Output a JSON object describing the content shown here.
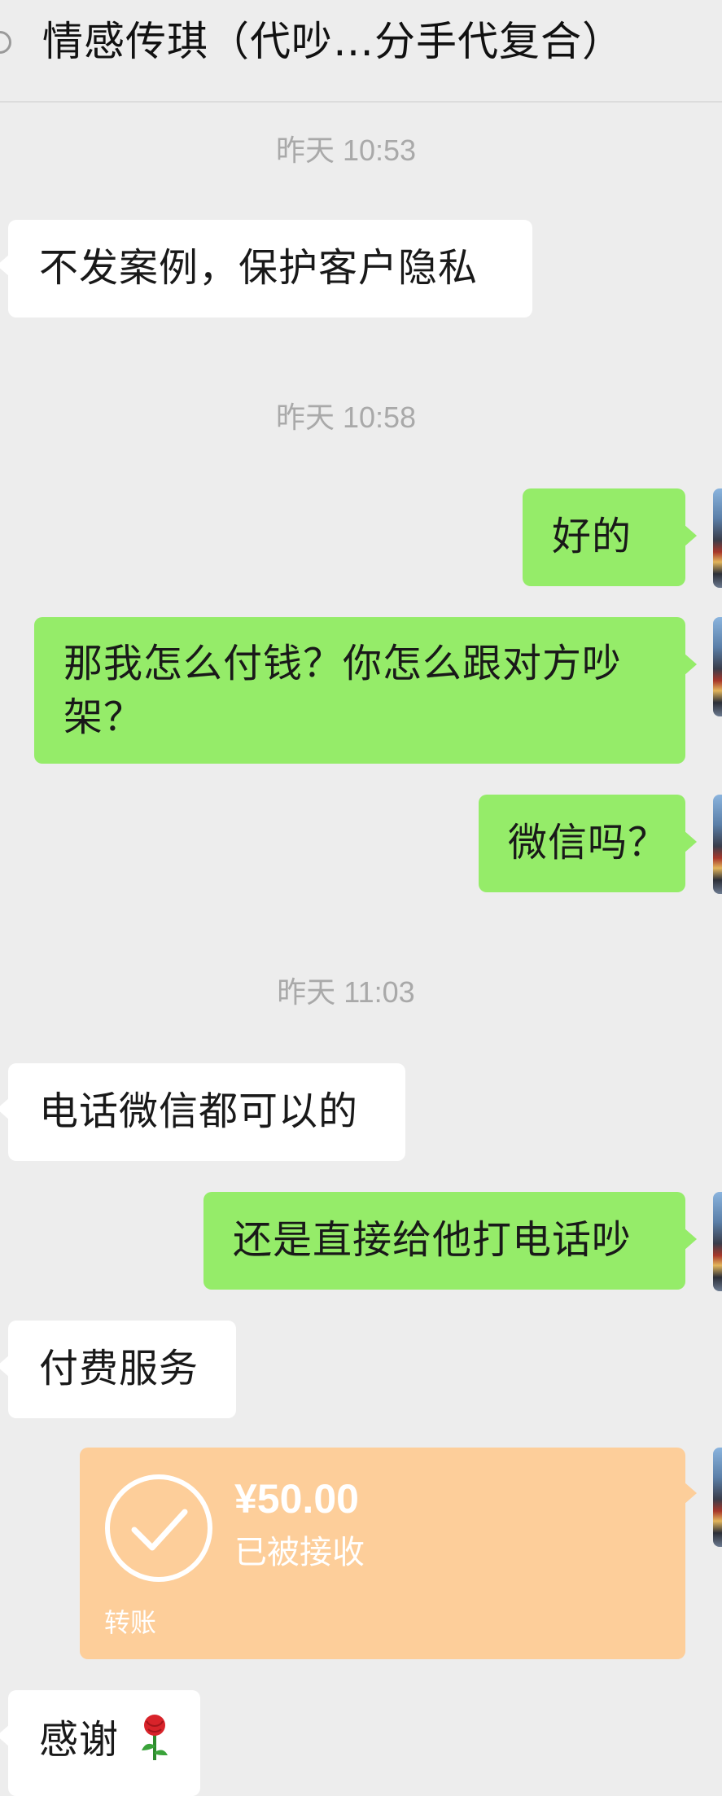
{
  "header": {
    "title": "情感传琪（代吵…分手代复合）"
  },
  "messages": [
    {
      "type": "time",
      "text": "昨天 10:53"
    },
    {
      "type": "in",
      "text": "不发案例，保护客户隐私"
    },
    {
      "type": "time",
      "text": "昨天 10:58"
    },
    {
      "type": "out",
      "text": "好的"
    },
    {
      "type": "out",
      "text": "那我怎么付钱？你怎么跟对方吵",
      "text2": "架？"
    },
    {
      "type": "out",
      "text": "微信吗？"
    },
    {
      "type": "time",
      "text": "昨天 11:03"
    },
    {
      "type": "in",
      "text": "电话微信都可以的"
    },
    {
      "type": "out",
      "text": "还是直接给他打电话吵"
    },
    {
      "type": "in",
      "text": "付费服务"
    },
    {
      "type": "transfer",
      "amount": "¥50.00",
      "status": "已被接收",
      "label": "转账"
    },
    {
      "type": "in",
      "text": "感谢",
      "emoji": "rose"
    }
  ],
  "colors": {
    "background": "#ededed",
    "incoming_bubble": "#ffffff",
    "outgoing_bubble": "#95ec69",
    "transfer_card": "#fdce9a",
    "timestamp": "#a9a9a9"
  }
}
